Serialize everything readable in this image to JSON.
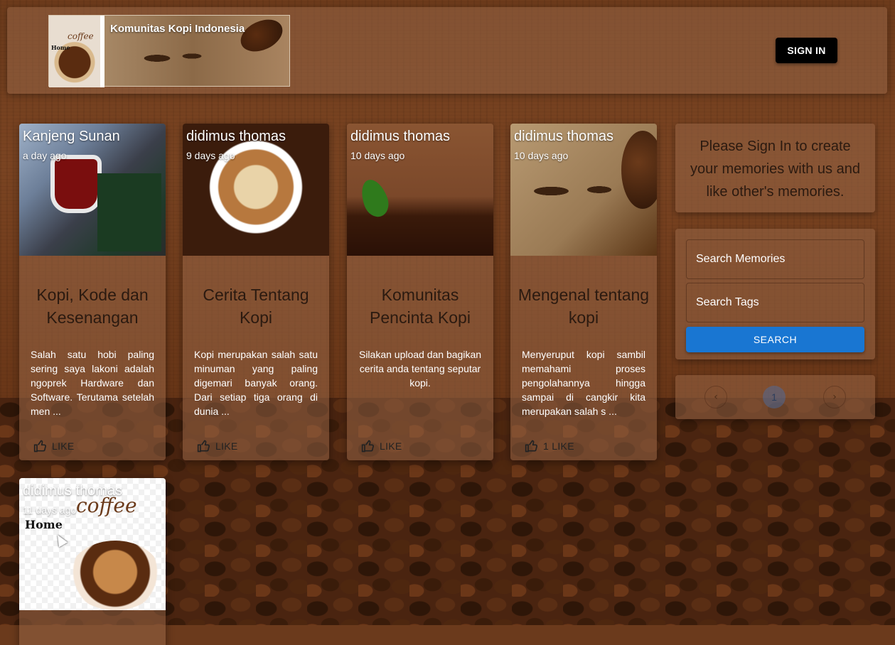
{
  "header": {
    "logo_title": "Komunitas Kopi Indonesia",
    "logo_small_home": "Home",
    "logo_small_coffee": "coffee",
    "signin_label": "SIGN IN"
  },
  "posts": [
    {
      "author": "Kanjeng Sunan",
      "time": "a day ago",
      "title": "Kopi, Kode dan Kesenangan",
      "body": "Salah satu hobi paling sering saya lakoni adalah ngoprek Hardware dan Software. Terutama setelah men ...",
      "like_label": "LIKE"
    },
    {
      "author": "didimus thomas",
      "time": "9 days ago",
      "title": "Cerita Tentang Kopi",
      "body": "Kopi merupakan salah satu minuman yang paling digemari banyak orang. Dari setiap tiga orang di dunia ...",
      "like_label": "LIKE"
    },
    {
      "author": "didimus thomas",
      "time": "10 days ago",
      "title": "Komunitas Pencinta Kopi",
      "body": "Silakan upload dan bagikan cerita anda tentang seputar kopi.",
      "like_label": "LIKE"
    },
    {
      "author": "didimus thomas",
      "time": "10 days ago",
      "title": "Mengenal tentang kopi",
      "body": "Menyeruput kopi sambil memahami proses pengolahannya hingga sampai di cangkir kita merupakan salah s ...",
      "like_label": "1 LIKE"
    },
    {
      "author": "didimus thomas",
      "time": "11 days ago",
      "image_home": "Home",
      "image_coffee": "coffee"
    }
  ],
  "sidebar": {
    "signin_message": "Please Sign In to create your memories with us and like other's memories.",
    "search_memories_placeholder": "Search Memories",
    "search_tags_placeholder": "Search Tags",
    "search_label": "SEARCH",
    "pager_prev": "‹",
    "pager_current": "1",
    "pager_next": "›"
  },
  "colors": {
    "search_button": "#1976d2",
    "signin_button": "#000000"
  }
}
